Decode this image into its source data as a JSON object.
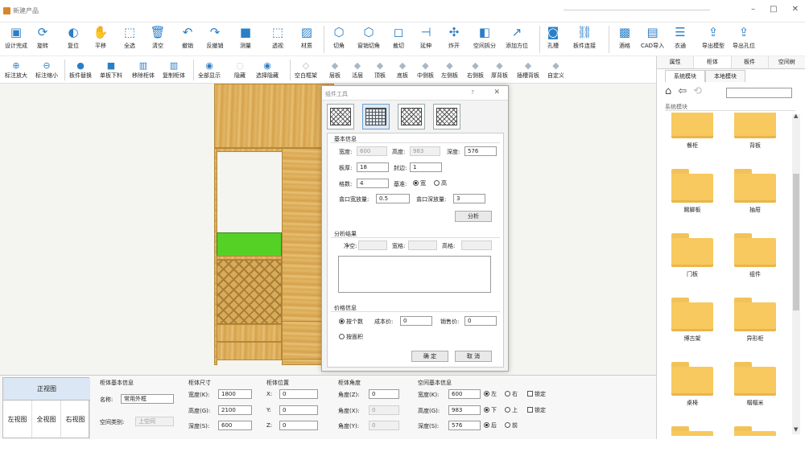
{
  "window": {
    "title": "新建产品",
    "controls": [
      "–",
      "□",
      "✕"
    ]
  },
  "toolbar1": [
    {
      "label": "设计完成",
      "icon": "save-icon",
      "glyph": "▣"
    },
    {
      "label": "旋转",
      "icon": "rotate-icon",
      "glyph": "⟳"
    },
    {
      "label": "复位",
      "icon": "reset-icon",
      "glyph": "◐"
    },
    {
      "label": "平移",
      "icon": "hand-icon",
      "glyph": "✋"
    },
    {
      "label": "全选",
      "icon": "select-all-icon",
      "glyph": "⬚"
    },
    {
      "label": "清空",
      "icon": "trash-icon",
      "glyph": "🗑"
    },
    {
      "label": "撤销",
      "icon": "undo-icon",
      "glyph": "↶"
    },
    {
      "label": "反撤销",
      "icon": "redo-icon",
      "glyph": "↷"
    },
    {
      "label": "测量",
      "icon": "measure-icon",
      "glyph": "■"
    },
    {
      "label": "透视",
      "icon": "perspective-icon",
      "glyph": "⬚"
    },
    {
      "label": "材质",
      "icon": "material-icon",
      "glyph": "▨"
    },
    {
      "label": "切角",
      "icon": "chamfer-icon",
      "glyph": "⬡"
    },
    {
      "label": "窗销切角",
      "icon": "window-chamfer-icon",
      "glyph": "⬡"
    },
    {
      "label": "裁切",
      "icon": "cut-icon",
      "glyph": "◻"
    },
    {
      "label": "延伸",
      "icon": "extend-icon",
      "glyph": "⊣"
    },
    {
      "label": "炸开",
      "icon": "explode-icon",
      "glyph": "✣"
    },
    {
      "label": "空间拆分",
      "icon": "split-icon",
      "glyph": "◧"
    },
    {
      "label": "添加方位",
      "icon": "axis-icon",
      "glyph": "↗"
    },
    {
      "label": "孔槽",
      "icon": "hole-icon",
      "glyph": "◙"
    },
    {
      "label": "板件连接",
      "icon": "link-icon",
      "glyph": "⛓"
    },
    {
      "label": "酒格",
      "icon": "wine-rack-icon",
      "glyph": "▩"
    },
    {
      "label": "CAD导入",
      "icon": "cad-icon",
      "glyph": "▤"
    },
    {
      "label": "衣通",
      "icon": "rail-icon",
      "glyph": "☰"
    },
    {
      "label": "导出模型",
      "icon": "export-model-icon",
      "glyph": "⇪"
    },
    {
      "label": "导出孔位",
      "icon": "pdf-icon",
      "glyph": "⇪"
    }
  ],
  "toolbar2": [
    {
      "label": "标注放大",
      "icon": "zoom-in-icon",
      "glyph": "⊕",
      "enabled": true
    },
    {
      "label": "标注缩小",
      "icon": "zoom-out-icon",
      "glyph": "⊖",
      "enabled": true
    },
    {
      "label": "板件替换",
      "icon": "replace-icon",
      "glyph": "●",
      "enabled": true
    },
    {
      "label": "单板下料",
      "icon": "board-icon",
      "glyph": "■",
      "enabled": true
    },
    {
      "label": "移除柜体",
      "icon": "remove-icon",
      "glyph": "▥",
      "enabled": true
    },
    {
      "label": "复制柜体",
      "icon": "copy-icon",
      "glyph": "▥",
      "enabled": true
    },
    {
      "label": "全部显示",
      "icon": "eye-icon",
      "glyph": "◉",
      "enabled": true
    },
    {
      "label": "隐藏",
      "icon": "hide-icon",
      "glyph": "◌",
      "enabled": false
    },
    {
      "label": "选择隐藏",
      "icon": "select-hide-icon",
      "glyph": "◉",
      "enabled": true
    },
    {
      "label": "空白框架",
      "icon": "frame-icon",
      "glyph": "◇",
      "enabled": false
    },
    {
      "label": "层板",
      "icon": "shelf-icon",
      "glyph": "◆",
      "enabled": false
    },
    {
      "label": "活层",
      "icon": "movable-shelf-icon",
      "glyph": "◆",
      "enabled": false
    },
    {
      "label": "顶板",
      "icon": "top-board-icon",
      "glyph": "◆",
      "enabled": false
    },
    {
      "label": "底板",
      "icon": "bottom-board-icon",
      "glyph": "◆",
      "enabled": false
    },
    {
      "label": "中侧板",
      "icon": "mid-side-icon",
      "glyph": "◆",
      "enabled": false
    },
    {
      "label": "左侧板",
      "icon": "left-side-icon",
      "glyph": "◆",
      "enabled": false
    },
    {
      "label": "右侧板",
      "icon": "right-side-icon",
      "glyph": "◆",
      "enabled": false
    },
    {
      "label": "厚背板",
      "icon": "thick-back-icon",
      "glyph": "◆",
      "enabled": false
    },
    {
      "label": "插槽背板",
      "icon": "slot-back-icon",
      "glyph": "◆",
      "enabled": false
    },
    {
      "label": "自定义",
      "icon": "custom-icon",
      "glyph": "◆",
      "enabled": false
    }
  ],
  "dialog": {
    "title": "组件工具",
    "help": "?",
    "close": "✕",
    "basic_title": "基本信息",
    "width_label": "宽度:",
    "width_value": "600",
    "height_label": "高度:",
    "height_value": "983",
    "depth_label": "深度:",
    "depth_value": "576",
    "thickness_label": "板厚:",
    "thickness_value": "18",
    "edge_label": "封边:",
    "edge_value": "1",
    "count_label": "格数:",
    "count_value": "4",
    "base_label": "基准:",
    "base_opt1": "宽",
    "base_opt2": "高",
    "gap_w_label": "翕口宽放量:",
    "gap_w_value": "0.5",
    "gap_d_label": "翕口深放量:",
    "gap_d_value": "3",
    "analyze_btn": "分析",
    "result_title": "分析结果",
    "net_label": "净空:",
    "grid_w_label": "宽格:",
    "grid_h_label": "高格:",
    "price_title": "价格信息",
    "by_count": "按个数",
    "cost_label": "成本价:",
    "cost_value": "0",
    "sale_label": "销售价:",
    "sale_value": "0",
    "by_area": "按面积",
    "ok_btn": "确 定",
    "cancel_btn": "取 消"
  },
  "right_panel": {
    "tabs": [
      "属性",
      "柜体",
      "板件",
      "空间树"
    ],
    "subtabs": [
      "系统模块",
      "本地模块"
    ],
    "breadcrumb": "系统模块",
    "folders": [
      "餐柜",
      "背板",
      "踢脚板",
      "抽屉",
      "门板",
      "组件",
      "博古架",
      "异形柜",
      "桌椅",
      "榻榻米",
      "",
      ""
    ]
  },
  "bottom": {
    "views": {
      "front": "正视图",
      "left": "左视图",
      "full": "全视图",
      "right": "右视图"
    },
    "cab_info": {
      "title": "柜体基本信息",
      "name_label": "名称:",
      "name_value": "常用外框",
      "space_label": "空间类别:",
      "space_value": "上空间"
    },
    "cab_size": {
      "title": "柜体尺寸",
      "w_label": "宽度(K):",
      "w_value": "1800",
      "h_label": "高度(G):",
      "h_value": "2100",
      "d_label": "深度(S):",
      "d_value": "600"
    },
    "cab_pos": {
      "title": "柜体位置",
      "x_label": "X:",
      "x_value": "0",
      "y_label": "Y:",
      "y_value": "0",
      "z_label": "Z:",
      "z_value": "0"
    },
    "cab_angle": {
      "title": "柜体角度",
      "z_label": "角度(Z):",
      "z_value": "0",
      "x_label": "角度(X):",
      "x_value": "0",
      "y_label": "角度(Y):",
      "y_value": "0"
    },
    "space_info": {
      "title": "空间基本信息",
      "w_label": "宽度(K):",
      "w_value": "600",
      "h_label": "高度(G):",
      "h_value": "983",
      "d_label": "深度(S):",
      "d_value": "576",
      "left": "左",
      "right": "右",
      "lock": "锁定",
      "down": "下",
      "up": "上",
      "back": "后",
      "front": "前"
    }
  },
  "colors": {
    "accent": "#2a7fc8",
    "selection": "#55d126",
    "folder": "#f7c95e"
  }
}
